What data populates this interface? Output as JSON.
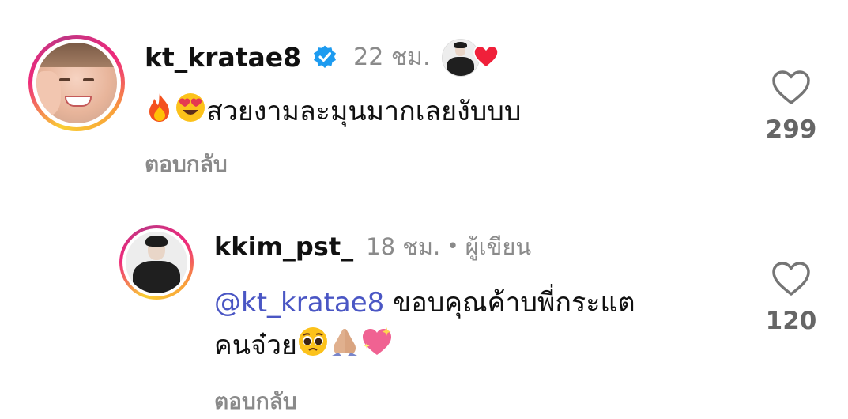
{
  "comments": [
    {
      "username": "kt_kratae8",
      "verified": true,
      "time": "22 ชม.",
      "text": "สวยงามละมุนมากเลยงับบบ",
      "emojis_before": [
        "fire-emoji",
        "heart-eyes-emoji"
      ],
      "reply_label": "ตอบกลับ",
      "like_count": "299",
      "liked_by_creator": true
    },
    {
      "username": "kkim_pst_",
      "time": "18 ชม.",
      "separator": "•",
      "author_tag": "ผู้เขียน",
      "mention": "@kt_kratae8",
      "text_line1": " ขอบคุณค้าบพี่กระแต",
      "text_line2": "คนจ๋วย",
      "emojis_after": [
        "pleading-face-emoji",
        "folded-hands-emoji",
        "sparkling-heart-emoji"
      ],
      "reply_label": "ตอบกลับ",
      "like_count": "120"
    }
  ],
  "colors": {
    "mention": "#4a56c4",
    "muted": "#8a8a8a",
    "verified": "#1d9bf0",
    "heart_red": "#f0203a"
  }
}
